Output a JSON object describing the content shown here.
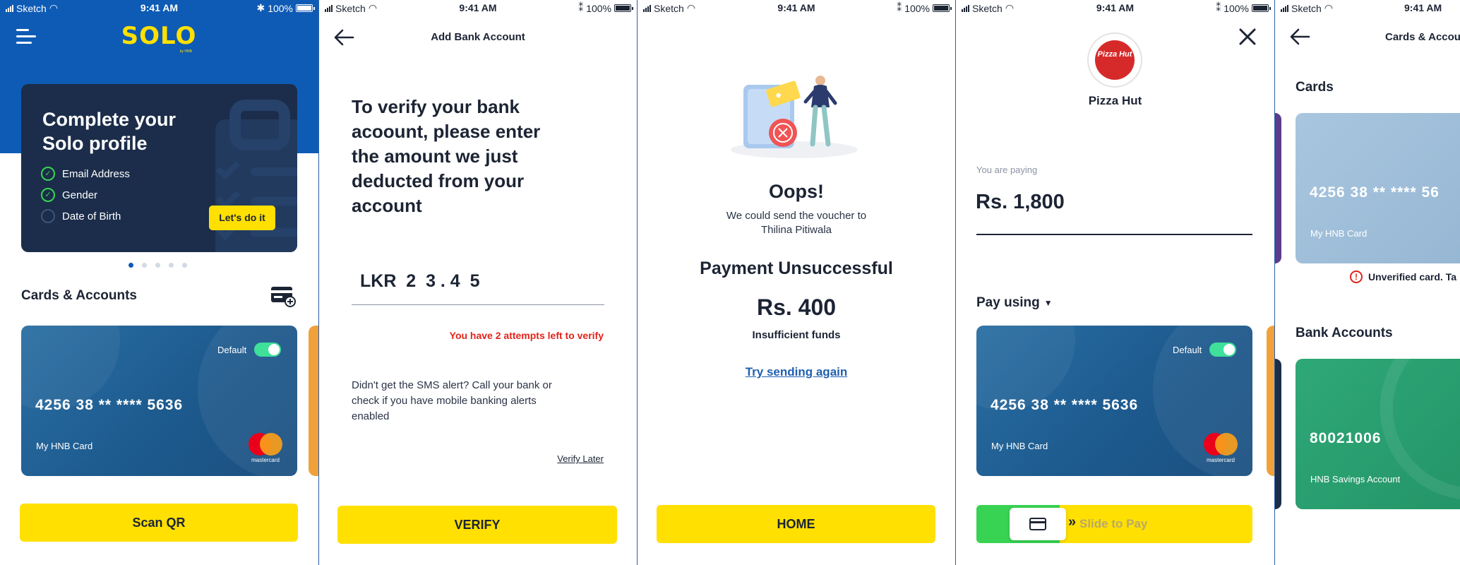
{
  "status": {
    "carrier": "Sketch",
    "time": "9:41 AM",
    "battery": "100%"
  },
  "home": {
    "logo": "SOLO",
    "logo_sub": "by HNB",
    "profile": {
      "title_line1": "Complete your",
      "title_line2": "Solo profile",
      "items": [
        {
          "label": "Email Address",
          "done": true
        },
        {
          "label": "Gender",
          "done": true
        },
        {
          "label": "Date of Birth",
          "done": false
        }
      ],
      "cta": "Let's do it",
      "page_count": 5,
      "active_page": 1
    },
    "cards_title": "Cards & Accounts",
    "card": {
      "default_label": "Default",
      "number": "4256 38 **   **** 5636",
      "name": "My HNB Card",
      "brand": "mastercard"
    },
    "scan_button": "Scan QR"
  },
  "verify": {
    "title": "Add Bank Account",
    "heading_lines": [
      "To verify your bank",
      "acoount, please enter",
      "the amount we just",
      "deducted from your",
      "account"
    ],
    "amount": "LKR  2  3 . 4  5",
    "attempts": "You have 2 attempts left to verify",
    "sms_lines": [
      "Didn't get the SMS alert? Call your bank or",
      "check if you have mobile banking alerts",
      "enabled"
    ],
    "verify_later": "Verify Later",
    "verify_button": "VERIFY"
  },
  "failure": {
    "oops": "Oops!",
    "message_line1": "We could send the voucher to",
    "message_line2": "Thilina Pitiwala",
    "status_title": "Payment Unsuccessful",
    "amount": "Rs. 400",
    "reason": "Insufficient funds",
    "retry": "Try sending again",
    "home_button": "HOME"
  },
  "pay": {
    "merchant": "Pizza Hut",
    "merchant_logo": "Pizza Hut",
    "paying_label": "You are paying",
    "amount": "Rs. 1,800",
    "pay_using": "Pay using",
    "card": {
      "default_label": "Default",
      "number": "4256 38 **   **** 5636",
      "name": "My HNB Card",
      "brand": "mastercard"
    },
    "slide": "Slide to Pay"
  },
  "accounts": {
    "title": "Cards & Accou",
    "cards_title": "Cards",
    "card": {
      "number": "4256 38 **   **** 56",
      "name": "My HNB Card"
    },
    "unverified": "Unverified card. Ta",
    "bank_title": "Bank Accounts",
    "bank": {
      "number": "80021006",
      "name": "HNB Savings Account"
    }
  },
  "colors": {
    "brand_blue": "#0e5bb5",
    "brand_yellow": "#ffe000",
    "navy": "#1b2d4a",
    "error_red": "#e2231a",
    "success_green": "#39d353",
    "link_blue": "#1f5fb0"
  }
}
